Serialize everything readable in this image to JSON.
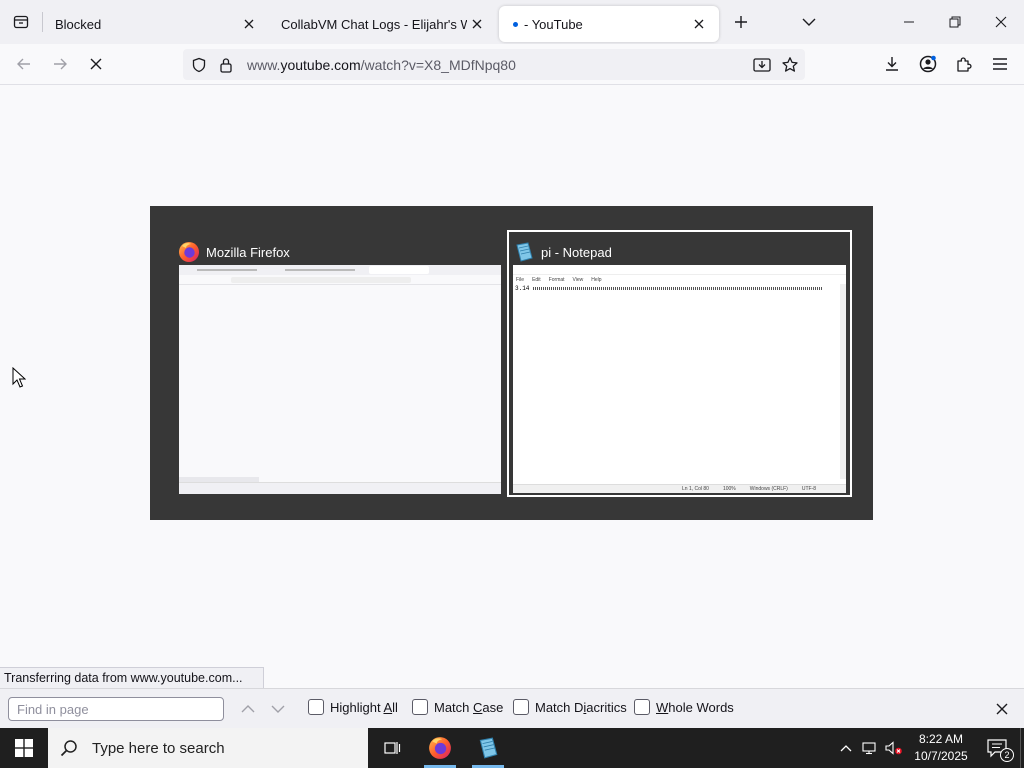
{
  "browser": {
    "tabs": [
      {
        "title": "Blocked",
        "active": false
      },
      {
        "title": "CollabVM Chat Logs - Elijahr's Webs",
        "active": false
      },
      {
        "title": "- YouTube",
        "active": true
      }
    ],
    "url_prefix": "www.",
    "url_host": "youtube.com",
    "url_path": "/watch?v=X8_MDfNpq80"
  },
  "switcher": {
    "items": [
      {
        "title": "Mozilla Firefox",
        "icon": "firefox-icon",
        "selected": false
      },
      {
        "title": "pi - Notepad",
        "icon": "notepad-icon",
        "selected": true
      }
    ],
    "notepad_thumb": {
      "menu": [
        "File",
        "Edit",
        "Format",
        "View",
        "Help"
      ],
      "text": "3.14",
      "status": [
        "Ln 1, Col 80",
        "100%",
        "Windows (CRLF)",
        "UTF-8"
      ]
    }
  },
  "status_text": "Transferring data from www.youtube.com...",
  "findbar": {
    "placeholder": "Find in page",
    "options": [
      {
        "pre": "Highlight ",
        "key": "A",
        "post": "ll"
      },
      {
        "pre": "Match ",
        "key": "C",
        "post": "ase"
      },
      {
        "pre": "Match D",
        "key": "i",
        "post": "acritics"
      },
      {
        "pre": "",
        "key": "W",
        "post": "hole Words"
      }
    ]
  },
  "taskbar": {
    "search_placeholder": "Type here to search",
    "time": "8:22 AM",
    "date": "10/7/2025",
    "notification_count": "2"
  },
  "colors": {
    "accent": "#0060df",
    "switcher_bg": "#373737",
    "taskbar_bg": "#1f1f1f"
  }
}
